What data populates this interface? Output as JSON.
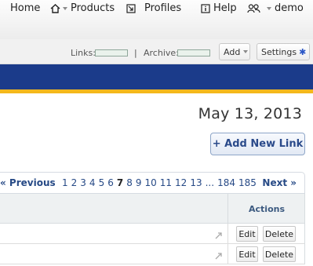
{
  "nav": {
    "home": "Home",
    "products": "Products",
    "profiles": "Profiles",
    "help": "Help",
    "user": "demo"
  },
  "toolbar": {
    "links_label": "Links:",
    "separator": "|",
    "archive_label": "Archive:",
    "add_label": "Add",
    "settings_label": "Settings"
  },
  "date": "May 13, 2013",
  "add_new_link": "+ Add New Link",
  "pagination": {
    "previous": "« Previous",
    "next": "Next »",
    "pages": [
      "1",
      "2",
      "3",
      "4",
      "5",
      "6",
      "7",
      "8",
      "9",
      "10",
      "11",
      "12",
      "13",
      "...",
      "184",
      "185"
    ],
    "current": "7"
  },
  "table": {
    "actions_header": "Actions",
    "rows": [
      {
        "edit": "Edit",
        "delete": "Delete"
      },
      {
        "edit": "Edit",
        "delete": "Delete"
      }
    ]
  },
  "colors": {
    "band": "#1b3b8a",
    "band_accent": "#f4b81c",
    "link": "#274a86"
  }
}
